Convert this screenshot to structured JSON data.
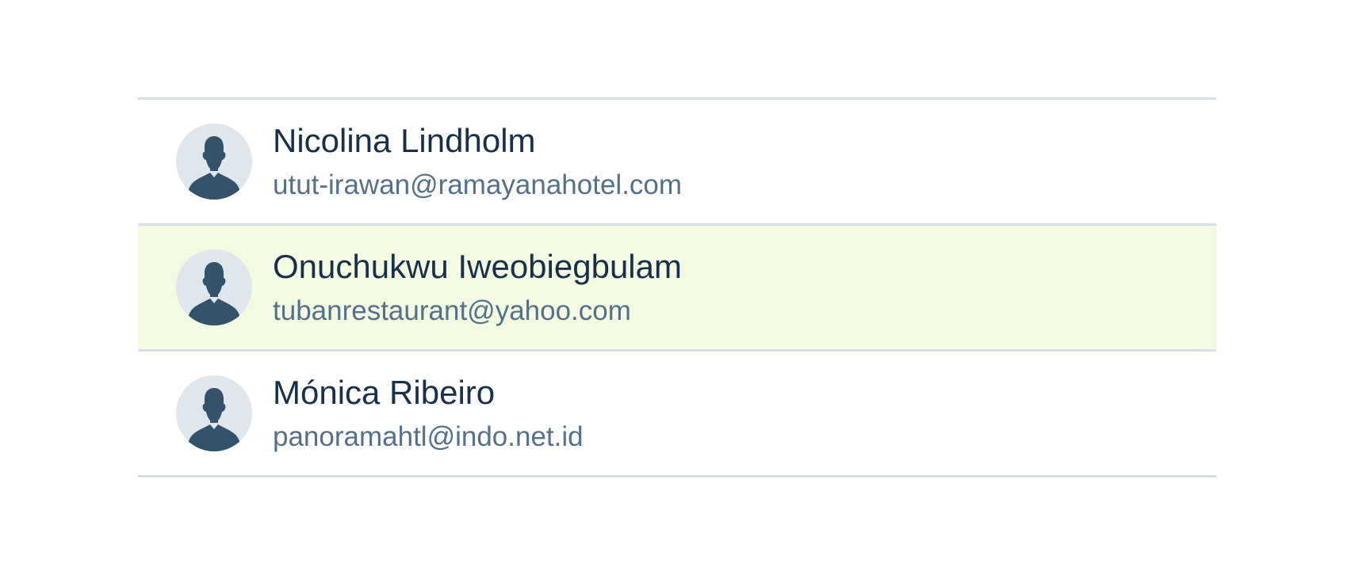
{
  "contacts": [
    {
      "name": "Nicolina Lindholm",
      "email": "utut-irawan@ramayanahotel.com",
      "avatar_icon": "person-silhouette-icon",
      "selected": false
    },
    {
      "name": "Onuchukwu Iweobiegbulam",
      "email": "tubanrestaurant@yahoo.com",
      "avatar_icon": "person-silhouette-icon",
      "selected": true
    },
    {
      "name": "Mónica Ribeiro",
      "email": "panoramahtl@indo.net.id",
      "avatar_icon": "person-silhouette-icon",
      "selected": false
    }
  ],
  "colors": {
    "selected_row_background": "#f2fbe2",
    "divider": "#d6dfe5",
    "name_text": "#183049",
    "email_text": "#54708a",
    "avatar_background": "#dfe6ec",
    "avatar_silhouette": "#34536b"
  }
}
